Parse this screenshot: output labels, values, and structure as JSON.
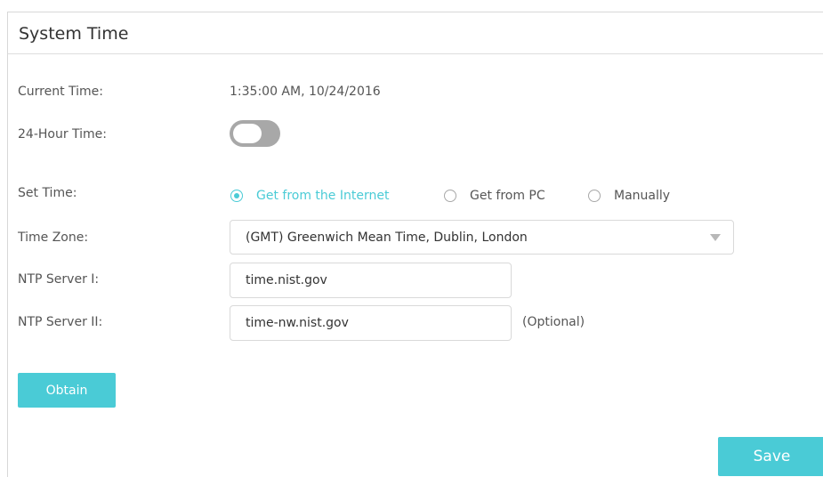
{
  "section": {
    "title": "System Time"
  },
  "current_time": {
    "label": "Current Time:",
    "value": "1:35:00 AM, 10/24/2016"
  },
  "hour24": {
    "label": "24-Hour Time:",
    "enabled": false
  },
  "set_time": {
    "label": "Set Time:",
    "options": [
      {
        "label": "Get from the Internet",
        "selected": true
      },
      {
        "label": "Get from PC",
        "selected": false
      },
      {
        "label": "Manually",
        "selected": false
      }
    ]
  },
  "time_zone": {
    "label": "Time Zone:",
    "selected": "(GMT) Greenwich Mean Time, Dublin, London"
  },
  "ntp1": {
    "label": "NTP Server I:",
    "value": "time.nist.gov"
  },
  "ntp2": {
    "label": "NTP Server II:",
    "value": "time-nw.nist.gov",
    "note": "(Optional)"
  },
  "buttons": {
    "obtain": "Obtain",
    "save": "Save"
  },
  "colors": {
    "accent": "#4acbd6",
    "toggle_off": "#a8a8a8",
    "text": "#555555"
  },
  "icons": {
    "dropdown": "caret-down-icon"
  }
}
